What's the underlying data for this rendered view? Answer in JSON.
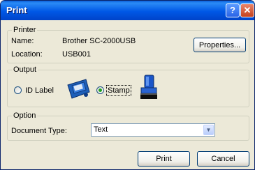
{
  "window": {
    "title": "Print"
  },
  "titlebar": {
    "help_glyph": "?",
    "close_glyph": "✕"
  },
  "printer": {
    "group_label": "Printer",
    "name_label": "Name:",
    "name_value": "Brother SC-2000USB",
    "location_label": "Location:",
    "location_value": "USB001",
    "properties_button": "Properties..."
  },
  "output": {
    "group_label": "Output",
    "options": [
      {
        "label": "ID Label",
        "selected": false,
        "icon": "id-label-icon"
      },
      {
        "label": "Stamp",
        "selected": true,
        "icon": "stamp-icon"
      }
    ]
  },
  "option": {
    "group_label": "Option",
    "document_type_label": "Document Type:",
    "document_type_value": "Text"
  },
  "footer": {
    "print_button": "Print",
    "cancel_button": "Cancel"
  },
  "colors": {
    "titlebar": "#0058e6",
    "window_bg": "#ece9d8",
    "selected_radio": "#21a121"
  }
}
